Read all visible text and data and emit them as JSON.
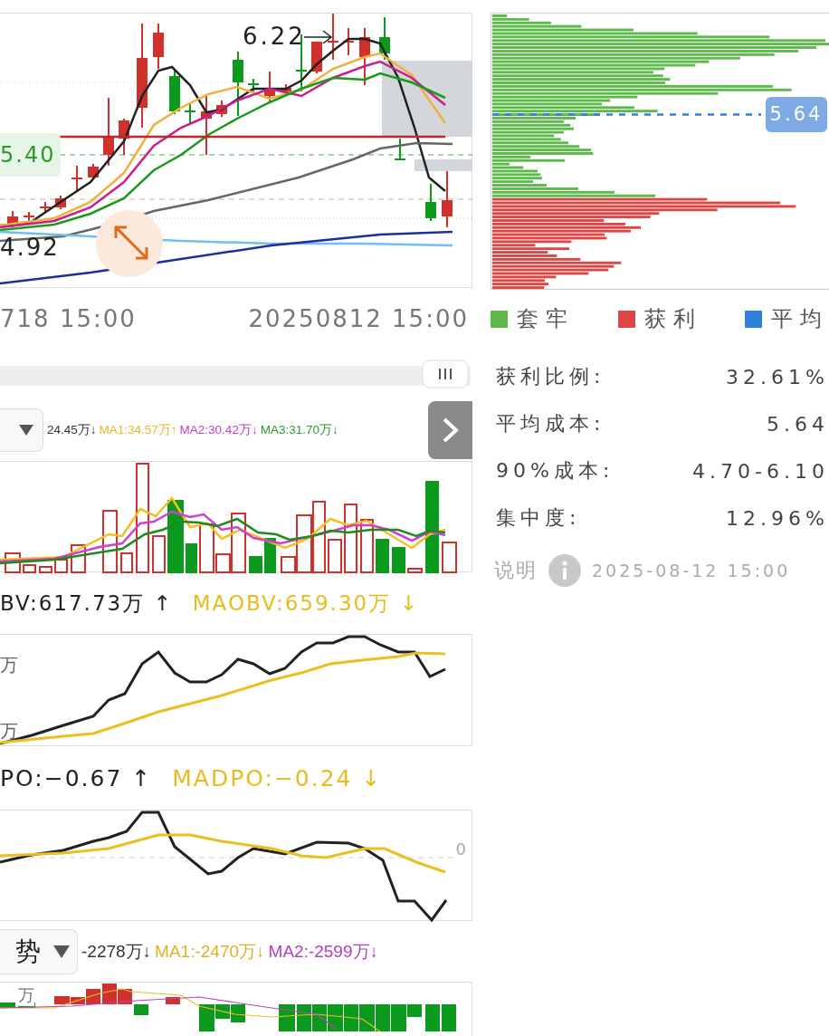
{
  "price_chart": {
    "high_label": "6.22",
    "price_badge": "5.40",
    "low_label": "4.92",
    "x_labels": [
      "718 15:00",
      "20250812 15:00"
    ]
  },
  "volume_panel": {
    "readings": [
      {
        "text": "24.45万↓",
        "color": "#333333"
      },
      {
        "text": "MA1:34.57万↑",
        "color": "#e8b820"
      },
      {
        "text": "MA2:30.42万↓",
        "color": "#c040c0"
      },
      {
        "text": "MA3:31.70万↓",
        "color": "#2c9a2c"
      }
    ]
  },
  "obv_panel": {
    "readings": [
      {
        "text": "BV:617.73万 ↑",
        "color": "#222222"
      },
      {
        "text": "MAOBV:659.30万 ↓",
        "color": "#e6bd1c"
      }
    ],
    "axis_labels": [
      "万",
      "万"
    ]
  },
  "dpo_panel": {
    "readings": [
      {
        "text": "PO:−0.67 ↑",
        "color": "#222222"
      },
      {
        "text": "MADPO:−0.24 ↓",
        "color": "#e6bd1c"
      }
    ],
    "zero_label": "0"
  },
  "trend_panel": {
    "selector": {
      "label": "势"
    },
    "readings": [
      {
        "text": "-2278万↓",
        "color": "#333333"
      },
      {
        "text": "MA1:-2470万↓",
        "color": "#e0b020"
      },
      {
        "text": "MA2:-2599万↓",
        "color": "#b040c0"
      }
    ],
    "axis_label": "万"
  },
  "chip_distribution": {
    "average_badge": "5.64",
    "legend": [
      {
        "label": "套牢",
        "color": "#5cb94a"
      },
      {
        "label": "获利",
        "color": "#e04545"
      },
      {
        "label": "平均",
        "color": "#2f7fdc"
      }
    ],
    "stats": [
      {
        "label": "获利比例:",
        "value": "32.61%"
      },
      {
        "label": "平均成本:",
        "value": "5.64"
      },
      {
        "label": "90%成本:",
        "value": "4.70-6.10"
      },
      {
        "label": "集中度:",
        "value": "12.96%"
      }
    ],
    "footer": {
      "link": "说明",
      "timestamp": "2025-08-12 15:00"
    }
  }
}
